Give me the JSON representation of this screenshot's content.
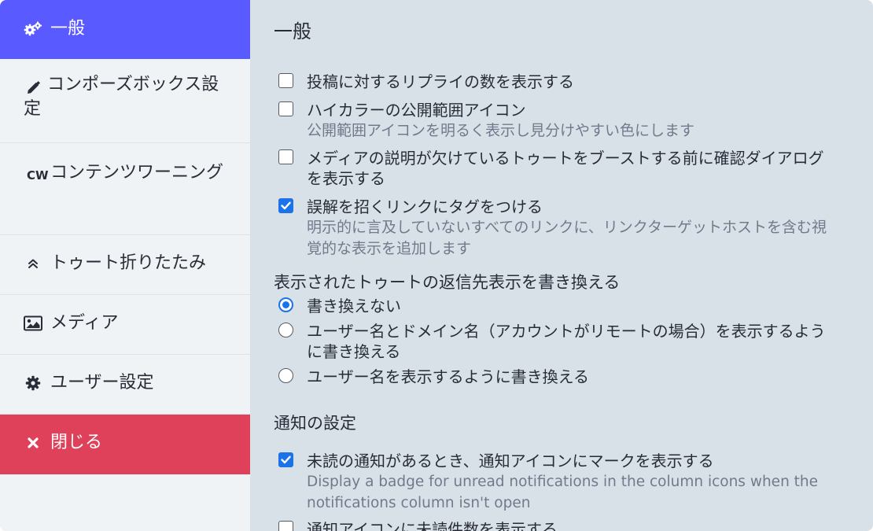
{
  "sidebar": {
    "general": "一般",
    "compose_box": "コンポーズボックス設定",
    "content_warning_badge": "CW",
    "content_warning": "コンテンツワーニング",
    "toot_collapse": "トゥート折りたたみ",
    "media": "メディア",
    "user_settings": "ユーザー設定",
    "close": "閉じる"
  },
  "main": {
    "title": "一般",
    "options": [
      {
        "label": "投稿に対するリプライの数を表示する",
        "checked": false
      },
      {
        "label": "ハイカラーの公開範囲アイコン",
        "hint": "公開範囲アイコンを明るく表示し見分けやすい色にします",
        "checked": false
      },
      {
        "label": "メディアの説明が欠けているトゥートをブーストする前に確認ダイアログを表示する",
        "checked": false
      },
      {
        "label": "誤解を招くリンクにタグをつける",
        "hint": "明示的に言及していないすべてのリンクに、リンクターゲットホストを含む視覚的な表示を追加します",
        "checked": true
      }
    ],
    "rewrite_section": {
      "title": "表示されたトゥートの返信先表示を書き換える",
      "options": [
        {
          "label": "書き換えない",
          "selected": true
        },
        {
          "label": "ユーザー名とドメイン名（アカウントがリモートの場合）を表示するように書き換える",
          "selected": false
        },
        {
          "label": "ユーザー名を表示するように書き換える",
          "selected": false
        }
      ]
    },
    "notifications_section": {
      "title": "通知の設定",
      "options": [
        {
          "label": "未読の通知があるとき、通知アイコンにマークを表示する",
          "hint": "Display a badge for unread notifications in the column icons when the notifications column isn't open",
          "checked": true
        },
        {
          "label": "通知アイコンに未読件数を表示する",
          "checked": false
        }
      ]
    }
  },
  "colors": {
    "accent": "#595aff",
    "danger": "#df405a",
    "checkbox": "#1a73e8",
    "content_bg": "#d9e1e8",
    "sidebar_bg": "#eff3f5"
  }
}
